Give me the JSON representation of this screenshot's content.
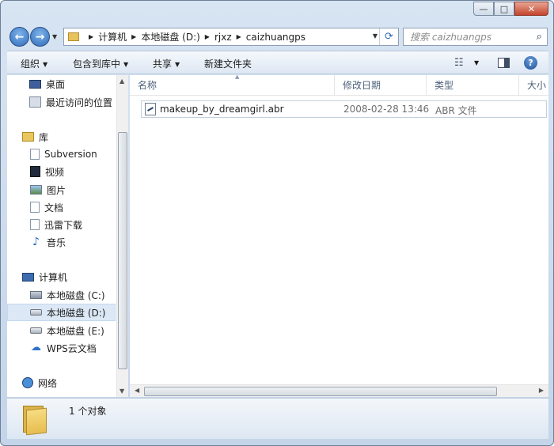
{
  "window": {
    "minimize_glyph": "—",
    "maximize_glyph": "□",
    "close_glyph": "✕"
  },
  "nav": {
    "back_glyph": "←",
    "forward_glyph": "→",
    "breadcrumb": [
      "计算机",
      "本地磁盘 (D:)",
      "rjxz",
      "caizhuangps"
    ],
    "search_placeholder": "搜索 caizhuangps"
  },
  "toolbar": {
    "organize": "组织",
    "include_in_library": "包含到库中",
    "share": "共享",
    "new_folder": "新建文件夹"
  },
  "sidebar": {
    "items": [
      {
        "label": "桌面",
        "icon": "desktop-icon"
      },
      {
        "label": "最近访问的位置",
        "icon": "recent-places-icon"
      },
      {
        "label": "库",
        "icon": "library-icon"
      },
      {
        "label": "Subversion",
        "icon": "document-icon"
      },
      {
        "label": "视频",
        "icon": "video-icon"
      },
      {
        "label": "图片",
        "icon": "picture-icon"
      },
      {
        "label": "文档",
        "icon": "document-icon"
      },
      {
        "label": "迅雷下载",
        "icon": "download-icon"
      },
      {
        "label": "音乐",
        "icon": "music-icon"
      },
      {
        "label": "计算机",
        "icon": "computer-icon"
      },
      {
        "label": "本地磁盘 (C:)",
        "icon": "system-drive-icon"
      },
      {
        "label": "本地磁盘 (D:)",
        "icon": "drive-icon",
        "selected": true
      },
      {
        "label": "本地磁盘 (E:)",
        "icon": "drive-icon"
      },
      {
        "label": "WPS云文档",
        "icon": "cloud-icon"
      },
      {
        "label": "网络",
        "icon": "network-icon"
      }
    ]
  },
  "files": {
    "columns": [
      "名称",
      "修改日期",
      "类型",
      "大小"
    ],
    "rows": [
      {
        "name": "makeup_by_dreamgirl.abr",
        "modified": "2008-02-28 13:46",
        "type": "ABR 文件",
        "icon": "abr-file-icon"
      }
    ]
  },
  "details": {
    "count_text": "1 个对象"
  },
  "colors": {
    "chrome": "#c4d5e9",
    "selection": "#dce8f6",
    "header_text": "#4c607a",
    "secondary_text": "#6d6d6d"
  }
}
